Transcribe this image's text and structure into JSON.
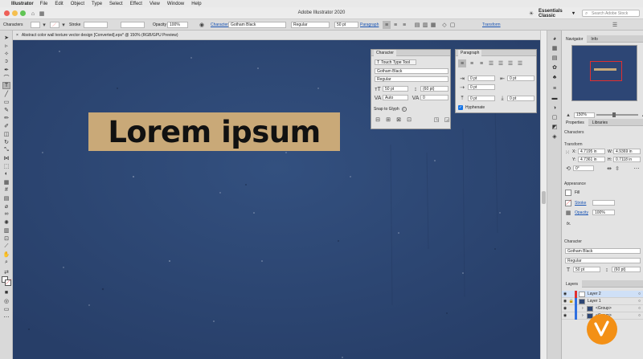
{
  "menubar": {
    "app": "Illustrator",
    "items": [
      "File",
      "Edit",
      "Object",
      "Type",
      "Select",
      "Effect",
      "View",
      "Window",
      "Help"
    ]
  },
  "window": {
    "title": "Adobe Illustrator 2020",
    "workspace": "Essentials Classic",
    "search_placeholder": "Search Adobe Stock"
  },
  "control_bar": {
    "characters_label": "Characters",
    "stroke_label": "Stroke",
    "opacity_label": "Opacity",
    "opacity_value": "100%",
    "character_link": "Character",
    "font": "Gotham Black",
    "style": "Regular",
    "size": "50 pt",
    "paragraph_link": "Paragraph",
    "transform_link": "Transform"
  },
  "document_tab": {
    "title": "Abstract color wall texture vector design [Converted].eps* @ 150% (RGB/GPU Preview)"
  },
  "canvas": {
    "background_color": "#2d4675",
    "text": "Lorem ipsum",
    "highlight_color": "#c9a978"
  },
  "character_panel": {
    "title": "Character",
    "touch_type_tool": "Touch Type Tool",
    "font": "Gotham Black",
    "style": "Regular",
    "size": "50 pt",
    "leading": "(60 pt)",
    "kerning": "Auto",
    "tracking": "0",
    "snap_to_glyph": "Snap to Glyph"
  },
  "paragraph_panel": {
    "title": "Paragraph",
    "left_indent": "0 pt",
    "right_indent": "0 pt",
    "first_line_indent": "0 pt",
    "space_before": "0 pt",
    "space_after": "0 pt",
    "hyphenate": "Hyphenate"
  },
  "navigator": {
    "tabs": [
      "Navigator",
      "Info"
    ],
    "zoom": "150%"
  },
  "properties": {
    "tabs": [
      "Properties",
      "Libraries"
    ],
    "selection": "Characters",
    "transform_label": "Transform",
    "x": "4.7195 in",
    "y": "4.7361 in",
    "w": "4.9369 in",
    "h": "0.7118 in",
    "angle": "0°",
    "appearance_label": "Appearance",
    "fill_label": "Fill",
    "stroke_label": "Stroke",
    "opacity_label": "Opacity",
    "opacity_value": "100%",
    "fx_label": "fx.",
    "character_label": "Character",
    "font": "Gotham Black",
    "style": "Regular",
    "size": "50 pt",
    "leading": "(60 pt)"
  },
  "layers": {
    "title": "Layers",
    "items": [
      "Layer 2",
      "Layer 1",
      "<Group>",
      "<Group>"
    ]
  }
}
